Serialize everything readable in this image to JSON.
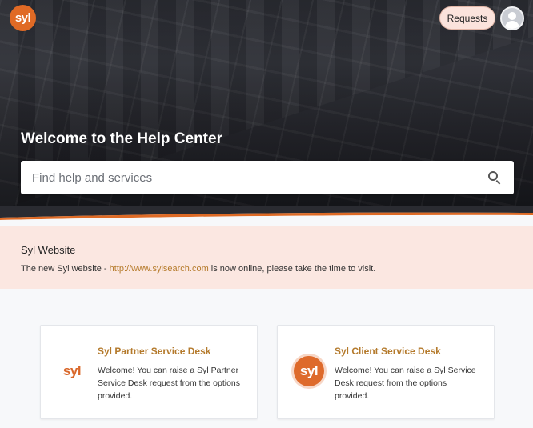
{
  "header": {
    "logo_text": "syl",
    "requests_label": "Requests"
  },
  "hero": {
    "title": "Welcome to the Help Center",
    "search_placeholder": "Find help and services"
  },
  "notice": {
    "title": "Syl Website",
    "text_before": "The new Syl website - ",
    "link_text": "http://www.sylsearch.com",
    "text_after": " is now online, please take the time to visit."
  },
  "cards": [
    {
      "icon_text": "syl",
      "title": "Syl Partner Service Desk",
      "description": "Welcome! You can raise a Syl Partner Service Desk request from the options provided."
    },
    {
      "icon_text": "syl",
      "title": "Syl Client Service Desk",
      "description": "Welcome! You can raise a Syl Service Desk request from the options provided."
    }
  ],
  "colors": {
    "brand_orange": "#e06a25",
    "link_gold": "#b57a2a",
    "notice_bg": "#fbe7e1"
  }
}
